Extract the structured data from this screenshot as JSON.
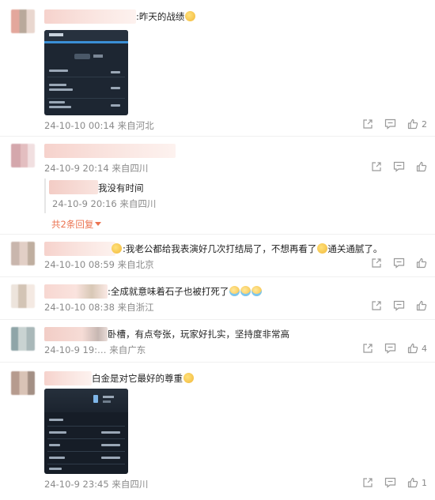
{
  "comments": [
    {
      "text": ":昨天的战绩",
      "meta": "24-10-10 00:14 来自河北",
      "like_count": "2",
      "has_image": true
    },
    {
      "text": "",
      "meta": "24-10-9 20:14 来自四川",
      "like_count": "",
      "reply": {
        "text": "我没有时间",
        "meta": "24-10-9 20:16 来自四川"
      },
      "more_replies": "共2条回复"
    },
    {
      "text": ":我老公都给我表演好几次打结局了，不想再看了",
      "text_tail": "通关通腻了。",
      "meta": "24-10-10 08:59 来自北京",
      "like_count": ""
    },
    {
      "text": ":全成就意味着石子也被打死了",
      "meta": "24-10-10 08:38 来自浙江",
      "like_count": ""
    },
    {
      "text": "卧槽，有点夸张，玩家好扎实，坚持度非常高",
      "meta": "24-10-9 19:…  来自广东",
      "like_count": "4"
    },
    {
      "text": "白金是对它最好的尊重",
      "meta": "24-10-9 23:45 来自四川",
      "like_count": "1",
      "has_image": true
    }
  ],
  "icons": {
    "share": "share-icon",
    "comment": "comment-icon",
    "like": "thumbs-up-icon",
    "caret": "caret-down-icon"
  },
  "colors": {
    "accent": "#eb7350",
    "meta": "#8a8a8a"
  }
}
